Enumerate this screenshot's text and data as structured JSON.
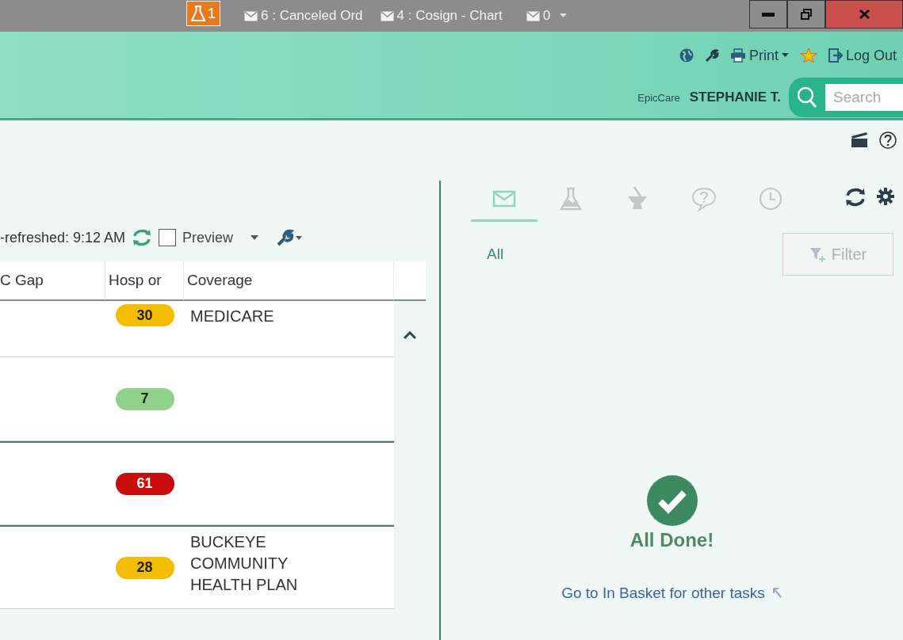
{
  "title_bar": {
    "lab_count": "1",
    "messages": [
      {
        "label": "6 : Canceled Ord"
      },
      {
        "label": "4 : Cosign - Chart"
      }
    ],
    "mail_count": "0"
  },
  "header": {
    "print_label": "Print",
    "logout_label": "Log Out",
    "app_name": "EpicCare",
    "user_name": "STEPHANIE T.",
    "search": {
      "placeholder": "Search"
    }
  },
  "worklist": {
    "refreshed": "-refreshed: 9:12 AM",
    "preview": {
      "label": "Preview",
      "checked": false
    },
    "table": {
      "columns": [
        "C Gap",
        "Hosp or",
        "Coverage"
      ],
      "rows": [
        {
          "hosp": "30",
          "color": "#f5bd00",
          "coverage": "MEDICARE",
          "group_start": false
        },
        {
          "hosp": "7",
          "color": "#8fd28c",
          "coverage": "",
          "group_start": false
        },
        {
          "hosp": "61",
          "color": "#c80c0c",
          "coverage": "",
          "group_start": true
        },
        {
          "hosp": "28",
          "color": "#f5bd00",
          "coverage": "BUCKEYE COMMUNITY HEALTH PLAN",
          "group_start": true
        }
      ]
    }
  },
  "in_basket": {
    "tabs": [
      {
        "kind": "mail",
        "selected": true
      },
      {
        "kind": "lab",
        "selected": false
      },
      {
        "kind": "rx",
        "selected": false
      },
      {
        "kind": "question",
        "selected": false
      },
      {
        "kind": "clock",
        "selected": false
      }
    ],
    "filter_label": "All",
    "filter_button": {
      "label": "Filter",
      "disabled": true
    },
    "status": "All Done!",
    "link": "Go to In Basket for other tasks"
  }
}
